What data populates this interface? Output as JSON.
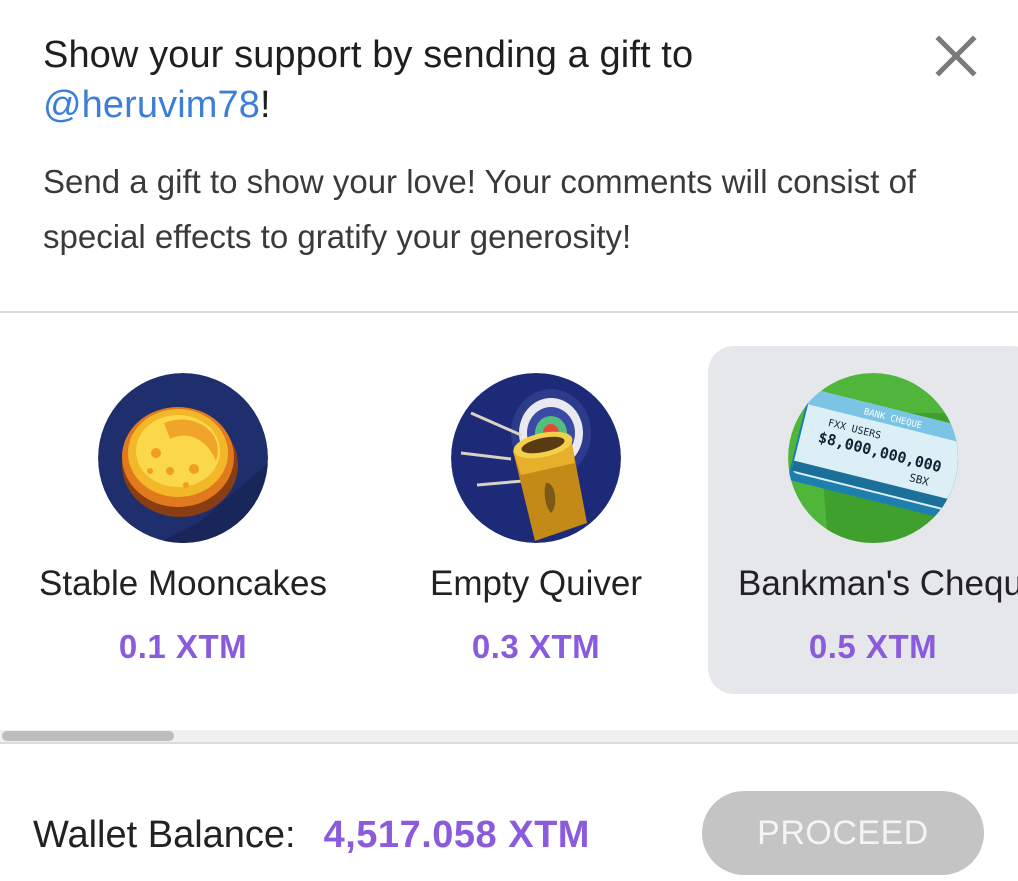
{
  "dialog": {
    "title_prefix": "Show your support by sending a gift to ",
    "title_handle": "@heruvim78",
    "title_suffix": "!",
    "description": "Send a gift to show your love! Your comments will consist of special effects to gratify your generosity!",
    "close_icon": "close-icon"
  },
  "gifts": [
    {
      "name": "Stable Mooncakes",
      "price": "0.1 XTM",
      "icon": "mooncake-icon",
      "selected": false
    },
    {
      "name": "Empty Quiver",
      "price": "0.3 XTM",
      "icon": "quiver-icon",
      "selected": false
    },
    {
      "name": "Bankman's Cheque",
      "price": "0.5 XTM",
      "icon": "cheque-icon",
      "selected": true,
      "cheque_text": {
        "line1": "FXX USERS",
        "line2": "$8,000,000,000",
        "line3": "SBX",
        "banner": "BANK CHEQUE"
      }
    }
  ],
  "footer": {
    "wallet_label": "Wallet Balance:",
    "wallet_value": "4,517.058 XTM",
    "proceed_label": "PROCEED"
  },
  "colors": {
    "accent_purple": "#8a5bdc",
    "handle_blue": "#3d7fd6",
    "selected_bg": "#e6e7ea",
    "disabled_button": "#c4c4c4"
  }
}
